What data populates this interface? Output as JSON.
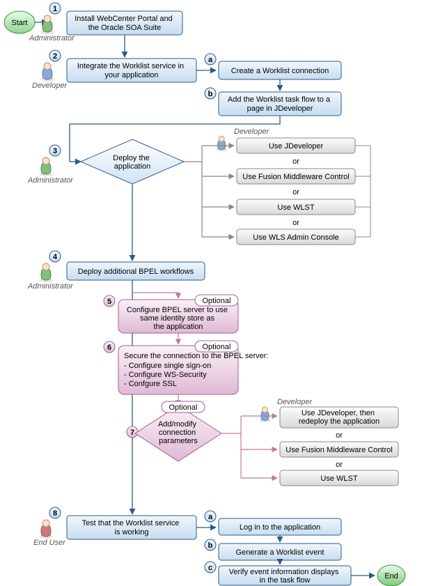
{
  "start": "Start",
  "end": "End",
  "roles": {
    "admin": "Administrator",
    "developer": "Developer",
    "enduser": "End User"
  },
  "steps": {
    "s1": "Install WebCenter Portal and the Oracle SOA Suite",
    "s2": "Integrate the Worklist service in your application",
    "s2a": "Create a Worklist connection",
    "s2b": "Add the Worklist task flow to a page in JDeveloper",
    "s3": "Deploy the application",
    "s3_opt1": "Use JDeveloper",
    "s3_opt2": "Use Fusion Middleware Control",
    "s3_opt3": "Use WLST",
    "s3_opt4": "Use WLS Admin Console",
    "s4": "Deploy additional BPEL workflows",
    "s5": "Configure BPEL server to use same identity store as the application",
    "s6_title": "Secure the connection to the BPEL server:",
    "s6_l1": "- Configure single sign-on",
    "s6_l2": "- Configure WS-Security",
    "s6_l3": "- Confgure SSL",
    "s7": "Add/modify connection parameters",
    "s7_opt1": "Use JDeveloper, then redeploy the application",
    "s7_opt2": "Use Fusion Middleware Control",
    "s7_opt3": "Use WLST",
    "s8": "Test that  the Worklist service is working",
    "s8a": "Log in to the application",
    "s8b": "Generate a Worklist event",
    "s8c": "Verify event information displays in the task flow"
  },
  "labels": {
    "or": "or",
    "optional": "Optional"
  }
}
